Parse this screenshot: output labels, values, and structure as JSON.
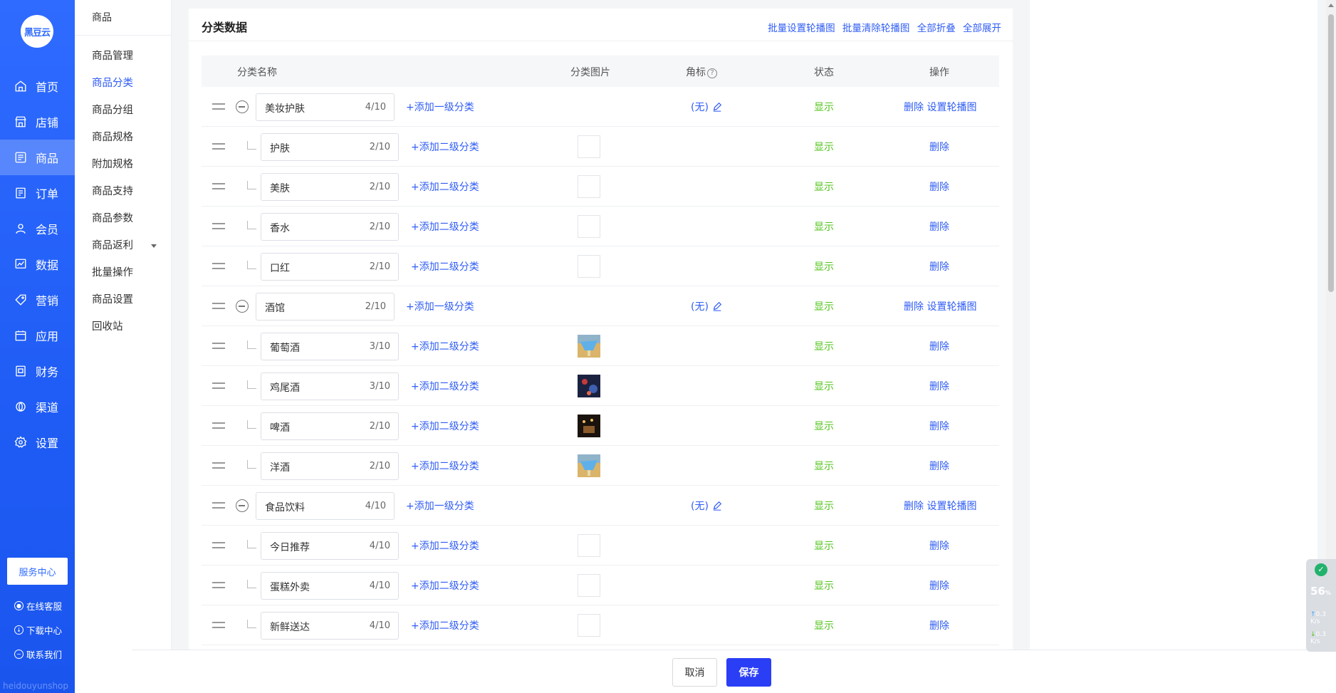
{
  "brand": {
    "logo_text": "黑豆云",
    "watermark": "heidouyunshop"
  },
  "nav": [
    {
      "label": "首页",
      "icon": "home-icon"
    },
    {
      "label": "店铺",
      "icon": "store-icon"
    },
    {
      "label": "商品",
      "icon": "goods-icon",
      "active": true
    },
    {
      "label": "订单",
      "icon": "order-icon"
    },
    {
      "label": "会员",
      "icon": "member-icon"
    },
    {
      "label": "数据",
      "icon": "chart-icon"
    },
    {
      "label": "营销",
      "icon": "tag-icon"
    },
    {
      "label": "应用",
      "icon": "app-icon"
    },
    {
      "label": "财务",
      "icon": "finance-icon"
    },
    {
      "label": "渠道",
      "icon": "channel-icon"
    },
    {
      "label": "设置",
      "icon": "gear-icon"
    }
  ],
  "service_center": "服务中心",
  "side_links": [
    "在线客服",
    "下载中心",
    "联系我们"
  ],
  "submenu": {
    "title": "商品",
    "items": [
      "商品管理",
      "商品分类",
      "商品分组",
      "商品规格",
      "附加规格",
      "商品支持",
      "商品参数",
      "商品返利",
      "批量操作",
      "商品设置",
      "回收站"
    ],
    "active_index": 1
  },
  "card": {
    "title": "分类数据",
    "actions": [
      "批量设置轮播图",
      "批量清除轮播图",
      "全部折叠",
      "全部展开"
    ]
  },
  "table": {
    "headers": {
      "name": "分类名称",
      "image": "分类图片",
      "badge": "角标",
      "status": "状态",
      "ops": "操作"
    },
    "add_level1": "+添加一级分类",
    "add_level2": "+添加二级分类",
    "badge_none": "(无)",
    "status_show": "显示",
    "op_delete": "删除",
    "op_carousel": "设置轮播图",
    "rows": [
      {
        "level": 1,
        "name": "美妆护肤",
        "count": "4/10"
      },
      {
        "level": 2,
        "name": "护肤",
        "count": "2/10",
        "img": "empty"
      },
      {
        "level": 2,
        "name": "美肤",
        "count": "2/10",
        "img": "empty"
      },
      {
        "level": 2,
        "name": "香水",
        "count": "2/10",
        "img": "empty"
      },
      {
        "level": 2,
        "name": "口红",
        "count": "2/10",
        "img": "empty"
      },
      {
        "level": 1,
        "name": "酒馆",
        "count": "2/10"
      },
      {
        "level": 2,
        "name": "葡萄酒",
        "count": "3/10",
        "img": "drink-blue"
      },
      {
        "level": 2,
        "name": "鸡尾酒",
        "count": "3/10",
        "img": "drink-red"
      },
      {
        "level": 2,
        "name": "啤酒",
        "count": "2/10",
        "img": "drink-dark"
      },
      {
        "level": 2,
        "name": "洋酒",
        "count": "2/10",
        "img": "drink-blue"
      },
      {
        "level": 1,
        "name": "食品饮料",
        "count": "4/10"
      },
      {
        "level": 2,
        "name": "今日推荐",
        "count": "4/10",
        "img": "empty"
      },
      {
        "level": 2,
        "name": "蛋糕外卖",
        "count": "4/10",
        "img": "empty"
      },
      {
        "level": 2,
        "name": "新鲜送达",
        "count": "4/10",
        "img": "empty"
      }
    ]
  },
  "footer": {
    "cancel": "取消",
    "save": "保存"
  },
  "speed_widget": {
    "percent": "56",
    "percent_unit": "%",
    "up": "0.3",
    "down": "0.3",
    "unit": "K/s"
  },
  "colors": {
    "primary": "#2f5cf4",
    "sidebar": "#2f6bff",
    "success": "#52c41a",
    "save_button": "#2a3ef5"
  }
}
